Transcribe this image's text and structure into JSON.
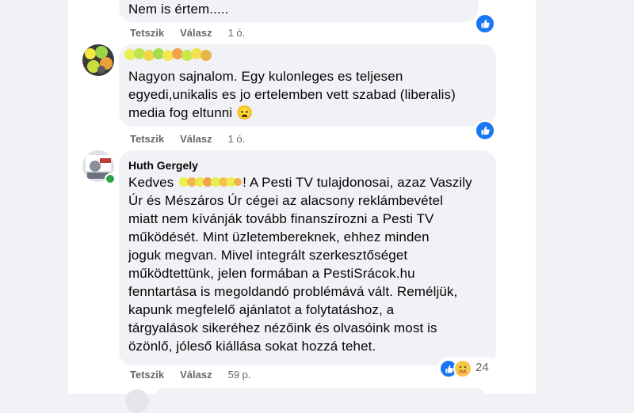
{
  "comments": [
    {
      "text": "Nem is értem.....",
      "actions": {
        "like": "Tetszik",
        "reply": "Válasz",
        "time": "1 ó."
      }
    },
    {
      "text": "Nagyon sajnalom. Egy kulonleges es teljesen\negyedi,unikalis es jo ertelemben vett szabad (liberalis)\nmedia fog eltunni 😦",
      "actions": {
        "like": "Tetszik",
        "reply": "Válasz",
        "time": "1 ó."
      }
    },
    {
      "author": "Huth Gergely",
      "text_prefix": "Kedves ",
      "text": "! A Pesti TV tulajdonosai, azaz Vaszily\nÚr és Mészáros Úr cégei az alacsony reklámbevétel\nmiatt nem kívánják tovább finanszírozni a Pesti TV\nműködését. Mint üzletembereknek, ehhez minden\njoguk megvan. Mivel integrált szerkesztőséget\nműködtettünk, jelen formában a PestiSrácok.hu\nfenntartása is megoldandó problémává vált. Reméljük,\nkapunk megfelelő ajánlatot a folytatáshoz, a\ntárgyalások sikeréhez nézőink és olvasóink most is\nözönlő, jóleső kiállása sokat hozzá tehet.",
      "actions": {
        "like": "Tetszik",
        "reply": "Válasz",
        "time": "59 p."
      },
      "reaction_count": "24"
    }
  ],
  "icons": {
    "like": "thumbs-up-icon",
    "care": "care-emoji-icon"
  },
  "colors": {
    "accent": "#1877f2",
    "bubble": "#f0f2f5",
    "online": "#31a24c"
  }
}
